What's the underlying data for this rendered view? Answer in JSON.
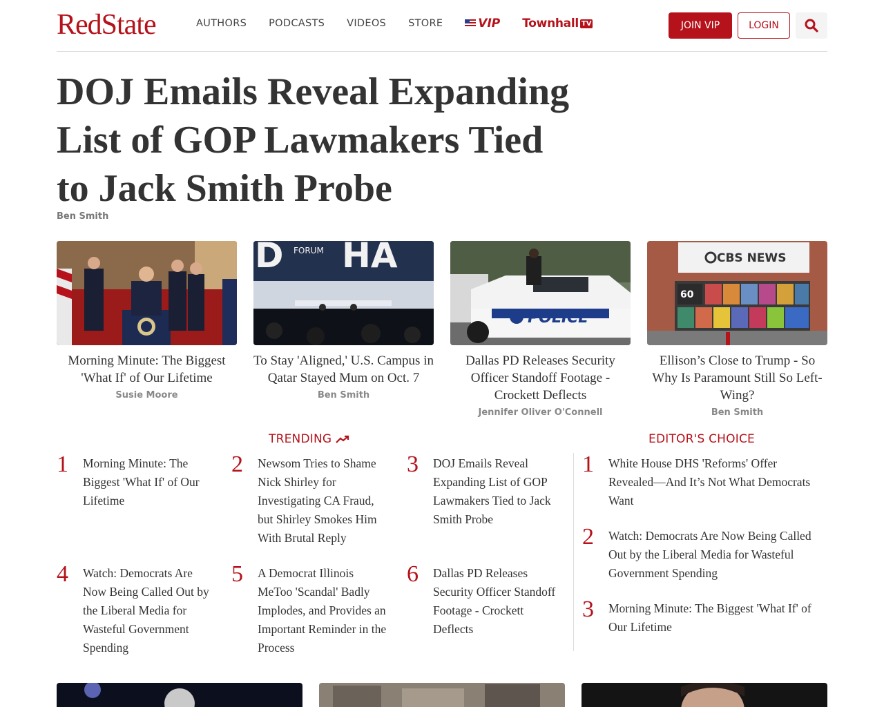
{
  "header": {
    "logo": "RedState",
    "nav": [
      "AUTHORS",
      "PODCASTS",
      "VIDEOS",
      "STORE"
    ],
    "vip_label": "VIP",
    "townhall_label": "Townhall",
    "townhall_tv": "TV",
    "join_label": "JOIN VIP",
    "login_label": "LOGIN",
    "search_icon": "search-icon"
  },
  "headline": {
    "title": "DOJ Emails Reveal Expanding List of GOP Lawmakers Tied to Jack Smith Probe",
    "author": "Ben Smith"
  },
  "cards": [
    {
      "title": "Morning Minute: The Biggest 'What If' of Our Lifetime",
      "author": "Susie Moore"
    },
    {
      "title": "To Stay 'Aligned,' U.S. Campus in Qatar Stayed Mum on Oct. 7",
      "author": "Ben Smith",
      "image_text_1": "FORUM",
      "image_text_2": "D",
      "image_text_3": "HA"
    },
    {
      "title": "Dallas PD Releases Security Officer Standoff Footage - Crockett Deflects",
      "author": "Jennifer Oliver O'Connell",
      "image_text": "POLICE"
    },
    {
      "title": "Ellison’s Close to Trump - So Why Is Paramount Still So Left-Wing?",
      "author": "Ben Smith",
      "image_text": "CBS NEWS",
      "image_text_2": "60"
    }
  ],
  "trending": {
    "label": "TRENDING",
    "items": [
      {
        "num": "1",
        "title": "Morning Minute: The Biggest 'What If' of Our Lifetime"
      },
      {
        "num": "2",
        "title": "Newsom Tries to Shame Nick Shirley for Investigating CA Fraud, but Shirley Smokes Him With Brutal Reply"
      },
      {
        "num": "3",
        "title": "DOJ Emails Reveal Expanding List of GOP Lawmakers Tied to Jack Smith Probe"
      },
      {
        "num": "4",
        "title": "Watch: Democrats Are Now Being Called Out by the Liberal Media for Wasteful Government Spending"
      },
      {
        "num": "5",
        "title": "A Democrat Illinois MeToo 'Scandal' Badly Implodes, and Provides an Important Reminder in the Process"
      },
      {
        "num": "6",
        "title": "Dallas PD Releases Security Officer Standoff Footage - Crockett Deflects"
      }
    ]
  },
  "editors_choice": {
    "label": "EDITOR'S CHOICE",
    "items": [
      {
        "num": "1",
        "title": "White House DHS 'Reforms' Offer Revealed—And It’s Not What Democrats Want"
      },
      {
        "num": "2",
        "title": "Watch: Democrats Are Now Being Called Out by the Liberal Media for Wasteful Government Spending"
      },
      {
        "num": "3",
        "title": "Morning Minute: The Biggest 'What If' of Our Lifetime"
      }
    ]
  },
  "colors": {
    "brand": "#b5121b",
    "text": "#333333",
    "muted": "#888888"
  }
}
